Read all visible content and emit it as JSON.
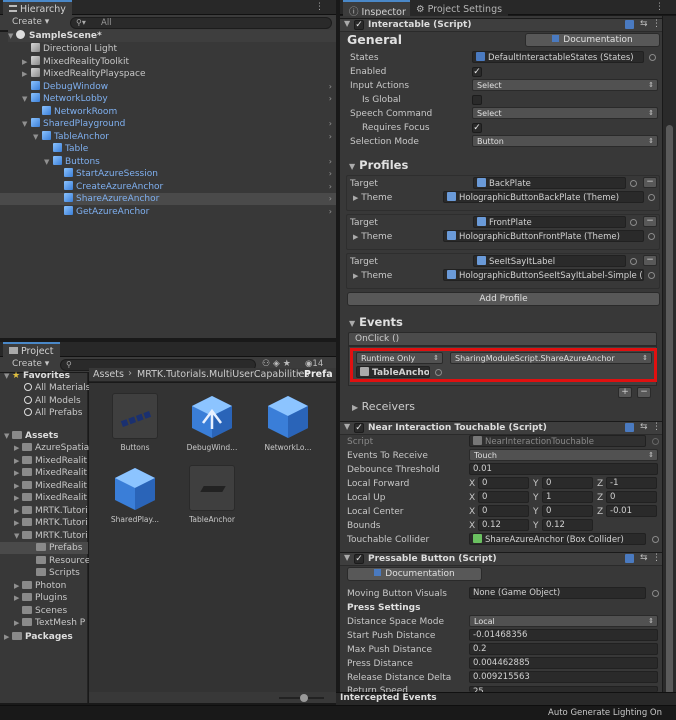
{
  "hierarchy": {
    "tab": "Hierarchy",
    "create": "Create",
    "search_all": "All",
    "scene": "SampleScene*",
    "items": [
      {
        "label": "Directional Light",
        "style": "gray",
        "depth": 1
      },
      {
        "label": "MixedRealityToolkit",
        "style": "gray",
        "depth": 1
      },
      {
        "label": "MixedRealityPlayspace",
        "style": "gray",
        "depth": 1
      },
      {
        "label": "DebugWindow",
        "style": "blue",
        "depth": 1
      },
      {
        "label": "NetworkLobby",
        "style": "blue",
        "depth": 1
      },
      {
        "label": "NetworkRoom",
        "style": "blue",
        "depth": 2
      },
      {
        "label": "SharedPlayground",
        "style": "blue",
        "depth": 1
      },
      {
        "label": "TableAnchor",
        "style": "blue",
        "depth": 2
      },
      {
        "label": "Table",
        "style": "blue",
        "depth": 3
      },
      {
        "label": "Buttons",
        "style": "blue",
        "depth": 3
      },
      {
        "label": "StartAzureSession",
        "style": "blue",
        "depth": 4
      },
      {
        "label": "CreateAzureAnchor",
        "style": "blue",
        "depth": 4
      },
      {
        "label": "ShareAzureAnchor",
        "style": "blue",
        "depth": 4
      },
      {
        "label": "GetAzureAnchor",
        "style": "blue",
        "depth": 4
      }
    ]
  },
  "project": {
    "tab": "Project",
    "create": "Create",
    "count": "14",
    "favorites": {
      "title": "Favorites",
      "items": [
        "All Materials",
        "All Models",
        "All Prefabs"
      ]
    },
    "assets": {
      "title": "Assets",
      "items": [
        "AzureSpatia",
        "MixedRealit",
        "MixedRealit",
        "MixedRealit",
        "MixedRealit",
        "MRTK.Tutori",
        "MRTK.Tutori",
        "MRTK.Tutori"
      ],
      "sub": [
        "Prefabs",
        "Resource",
        "Scripts"
      ],
      "more": [
        "Photon",
        "Plugins",
        "Scenes",
        "TextMesh P"
      ]
    },
    "packages": "Packages",
    "breadcrumb": {
      "a": "Assets",
      "sep": "›",
      "b": "MRTK.Tutorials.MultiUserCapabilities",
      "c": "Prefa"
    },
    "grid": [
      "Buttons",
      "DebugWind...",
      "NetworkLo...",
      "SharedPlay...",
      "TableAnchor"
    ]
  },
  "inspector": {
    "tabs": {
      "inspector": "Inspector",
      "settings": "Project Settings"
    },
    "interactable": {
      "title": "Interactable (Script)",
      "general": "General",
      "documentation": "Documentation",
      "states_label": "States",
      "states_value": "DefaultInteractableStates (States)",
      "enabled_label": "Enabled",
      "input_actions_label": "Input Actions",
      "input_actions_value": "Select",
      "is_global_label": "Is Global",
      "speech_label": "Speech Command",
      "speech_value": "Select",
      "requires_focus_label": "Requires Focus",
      "selection_mode_label": "Selection Mode",
      "selection_mode_value": "Button",
      "profiles": "Profiles",
      "profile_list": [
        {
          "target_label": "Target",
          "target": "BackPlate",
          "theme_label": "Theme",
          "theme": "HolographicButtonBackPlate (Theme)"
        },
        {
          "target_label": "Target",
          "target": "FrontPlate",
          "theme_label": "Theme",
          "theme": "HolographicButtonFrontPlate (Theme)"
        },
        {
          "target_label": "Target",
          "target": "SeeItSayItLabel",
          "theme_label": "Theme",
          "theme": "HolographicButtonSeeItSayItLabel-Simple ("
        }
      ],
      "add_profile": "Add Profile",
      "events": "Events",
      "onclick": "OnClick ()",
      "runtime": "Runtime Only",
      "function": "SharingModuleScript.ShareAzureAnchor",
      "object": "TableAnchor",
      "receivers": "Receivers",
      "plus": "+",
      "minus": "−"
    },
    "touchable": {
      "title": "Near Interaction Touchable (Script)",
      "script_label": "Script",
      "script_value": "NearInteractionTouchable",
      "events_label": "Events To Receive",
      "events_value": "Touch",
      "debounce_label": "Debounce Threshold",
      "debounce_value": "0.01",
      "forward_label": "Local Forward",
      "forward": [
        "0",
        "0",
        "-1"
      ],
      "up_label": "Local Up",
      "up": [
        "0",
        "1",
        "0"
      ],
      "center_label": "Local Center",
      "center": [
        "0",
        "0",
        "-0.01"
      ],
      "bounds_label": "Bounds",
      "bounds": [
        "0.12",
        "0.12"
      ],
      "collider_label": "Touchable Collider",
      "collider_value": "ShareAzureAnchor (Box Collider)",
      "axis": [
        "X",
        "Y",
        "Z"
      ]
    },
    "pressable": {
      "title": "Pressable Button (Script)",
      "documentation": "Documentation",
      "moving_label": "Moving Button Visuals",
      "moving_value": "None (Game Object)",
      "press_settings": "Press Settings",
      "distance_mode_label": "Distance Space Mode",
      "distance_mode_value": "Local",
      "start_push_label": "Start Push Distance",
      "start_push_value": "-0.01468356",
      "max_push_label": "Max Push Distance",
      "max_push_value": "0.2",
      "press_distance_label": "Press Distance",
      "press_distance_value": "0.004462885",
      "release_label": "Release Distance Delta",
      "release_value": "0.009215563",
      "return_label": "Return Speed",
      "return_value": "25"
    },
    "intercepted": "Intercepted Events"
  },
  "status": {
    "text": "Auto Generate Lighting On"
  }
}
